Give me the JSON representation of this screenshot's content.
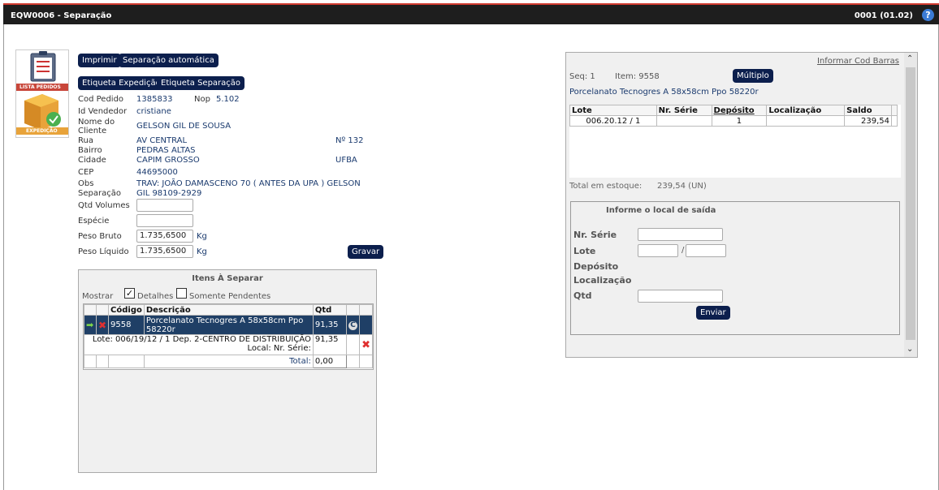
{
  "window": {
    "title": "EQW0006 - Separação",
    "version": "0001 (01.02)",
    "help_icon": "?"
  },
  "logo": {
    "top_label": "LISTA PEDIDOS",
    "bottom_label": "EXPEDIÇÃO"
  },
  "toolbar": {
    "imprimir": "Imprimir",
    "separacao_automatica": "Separação automática",
    "etiqueta_expedicao": "Etiqueta Expedição",
    "etiqueta_separacao": "Etiqueta Separação"
  },
  "order": {
    "cod_pedido_label": "Cod Pedido",
    "cod_pedido": "1385833",
    "nop_label": "Nop",
    "nop": "5.102",
    "id_vendedor_label": "Id Vendedor",
    "id_vendedor": "cristiane",
    "nome_label": "Nome do Cliente",
    "nome": "GELSON GIL DE SOUSA",
    "rua_label": "Rua",
    "rua": "AV CENTRAL",
    "numero": "Nº 132",
    "bairro_label": "Bairro",
    "bairro": "PEDRAS ALTAS",
    "cidade_label": "Cidade",
    "cidade": "CAPIM GROSSO",
    "uf": "UFBA",
    "cep_label": "CEP",
    "cep": "44695000",
    "obs_label": "Obs",
    "obs": "TRAV: JOÃO DAMASCENO 70 ( ANTES DA UPA ) GELSON",
    "separacao_label": "Separação",
    "separacao": "GIL 98109-2929",
    "qtd_volumes_label": "Qtd Volumes",
    "qtd_volumes": "",
    "especie_label": "Espécie",
    "especie": "",
    "peso_bruto_label": "Peso Bruto",
    "peso_bruto": "1.735,6500",
    "peso_bruto_unit": "Kg",
    "peso_liquido_label": "Peso Líquido",
    "peso_liquido": "1.735,6500",
    "peso_liquido_unit": "Kg",
    "gravar": "Gravar"
  },
  "items_panel": {
    "title": "Itens À Separar",
    "mostrar": "Mostrar",
    "detalhes": "Detalhes",
    "somente_pendentes": "Somente Pendentes",
    "headers": {
      "codigo": "Código",
      "descricao": "Descrição",
      "qtd": "Qtd"
    },
    "row": {
      "codigo": "9558",
      "descricao": "Porcelanato Tecnogres A 58x58cm Ppo 58220r",
      "qtd": "91,35"
    },
    "detail": {
      "text": "Lote: 006/19/12 / 1 Dep. 2-CENTRO DE DISTRIBUIÇÃO",
      "local": "Local: Nr. Série:",
      "qtd": "91,35"
    },
    "total_label": "Total:",
    "total": "0,00"
  },
  "right_panel": {
    "informar_cod_barras": "Informar Cod Barras",
    "seq_label": "Seq: 1",
    "item_label": "Item: 9558",
    "multiplo": "Múltiplo",
    "product": "Porcelanato Tecnogres A 58x58cm Ppo 58220r",
    "headers": {
      "lote": "Lote",
      "nr_serie": "Nr. Série",
      "deposito": "Depósito",
      "localizacao": "Localização",
      "saldo": "Saldo"
    },
    "row": {
      "lote": "006.20.12 / 1",
      "nr_serie": "",
      "deposito": "1",
      "localizacao": "",
      "saldo": "239,54"
    },
    "total_label": "Total em estoque:",
    "total_value": "239,54 (UN)",
    "saida_title": "Informe o local de saída",
    "nr_serie_label": "Nr. Série",
    "lote_label": "Lote",
    "lote_sep": "/",
    "deposito_label": "Depósito",
    "localizacao_label": "Localização",
    "qtd_label": "Qtd",
    "enviar": "Enviar"
  }
}
